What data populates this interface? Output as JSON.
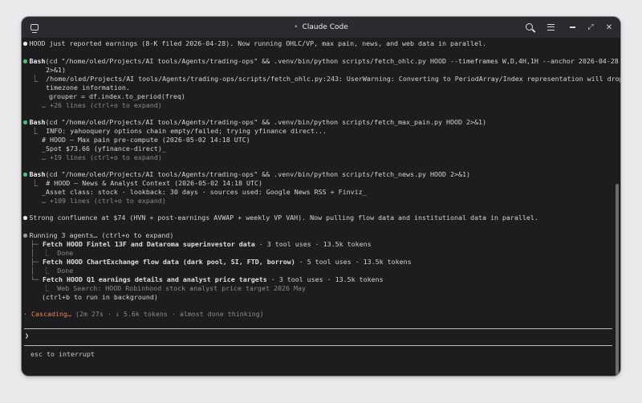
{
  "window": {
    "title": "Claude Code"
  },
  "titlebar": {
    "icons": [
      "terminal-icon",
      "search-icon",
      "menu-icon",
      "minimize-icon",
      "maximize-icon",
      "close-icon"
    ],
    "max_glyph": "⤢",
    "close_glyph": "✕"
  },
  "colors": {
    "success_dot": "#4ec07a",
    "active": "#e8835f",
    "background": "#1d1d20"
  },
  "log": {
    "l1": "HOOD just reported earnings (8-K filed 2026-04-28). Now running OHLC/VP, max pain, news, and web data in parallel.",
    "l2_tool": "Bash",
    "l2_cmd": "(cd \"/home/oled/Projects/AI tools/Agents/trading-ops\" && .venv/bin/python scripts/fetch_ohlc.py HOOD --timeframes W,D,4H,1H --anchor 2026-04-28",
    "l2_cont": "2>&1)",
    "l3": "⎿  /home/oled/Projects/AI tools/Agents/trading-ops/scripts/fetch_ohlc.py:243: UserWarning: Converting to PeriodArray/Index representation will drop",
    "l4": "timezone information.",
    "l5": "grouper = df.index.to_period(freq)",
    "l6": "… +26 lines (ctrl+o to expand)",
    "l7_tool": "Bash",
    "l7_cmd": "(cd \"/home/oled/Projects/AI tools/Agents/trading-ops\" && .venv/bin/python scripts/fetch_max_pain.py HOOD 2>&1)",
    "l8": "⎿  INFO: yahooquery options chain empty/failed; trying yfinance direct...",
    "l9": "# HOOD — Max pain pre-compute (2026-05-02 14:18 UTC)",
    "l10": "_Spot $73.66 (yfinance-direct)_",
    "l11": "… +19 lines (ctrl+o to expand)",
    "l12_tool": "Bash",
    "l12_cmd": "(cd \"/home/oled/Projects/AI tools/Agents/trading-ops\" && .venv/bin/python scripts/fetch_news.py HOOD 2>&1)",
    "l13": "⎿  # HOOD — News & Analyst Context (2026-05-02 14:18 UTC)",
    "l14": "_Asset class: stock · lookback: 30 days · sources used: Google News RSS + Finviz_",
    "l15": "… +109 lines (ctrl+o to expand)",
    "l16": "Strong confluence at $74 (HVN + post-earnings AVWAP + weekly VP VAH). Now pulling flow data and institutional data in parallel.",
    "l17": "Running 3 agents… (ctrl+o to expand)",
    "a1_prefix": "├─ ",
    "a1_name": "Fetch HOOD Fintel 13F and Dataroma superinvestor data",
    "a1_stats": " · 3 tool uses · 13.5k tokens",
    "a1_status": "│  ⎿  Done",
    "a2_prefix": "├─ ",
    "a2_name": "Fetch HOOD ChartExchange flow data (dark pool, SI, FTD, borrow)",
    "a2_stats": " · 5 tool uses · 13.5k tokens",
    "a2_status": "│  ⎿  Done",
    "a3_prefix": "└─ ",
    "a3_name": "Fetch HOOD Q1 earnings details and analyst price targets",
    "a3_stats": " · 3 tool uses · 13.5k tokens",
    "a3_status": "   ⎿  Web Search: HOOD Robinhood stock analyst price target 2026 May",
    "l18": "(ctrl+b to run in background)",
    "status_glyph": "·",
    "status_word": "Cascading…",
    "status_rest": " (2m 27s · ↓ 5.6k tokens · almost done thinking)"
  },
  "input": {
    "prompt": "❯",
    "value": ""
  },
  "footer": {
    "hint": "esc to interrupt"
  }
}
